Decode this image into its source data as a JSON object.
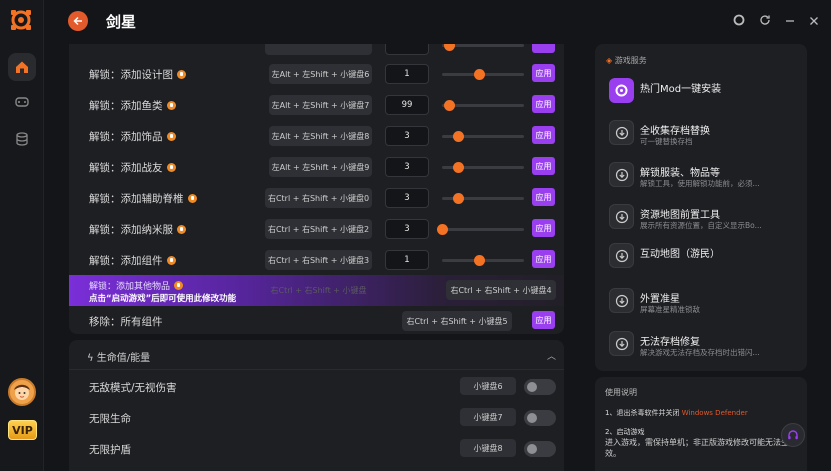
{
  "app": {
    "title": "剑星"
  },
  "rail": {
    "vip_label": "VIP"
  },
  "mods": [
    {
      "label": "解锁：添加设计图",
      "hotkey": "左Alt + 左Shift + 小键盘6",
      "value": "1",
      "slider": 0.45,
      "apply": "应用"
    },
    {
      "label": "解锁：添加鱼类",
      "hotkey": "左Alt + 左Shift + 小键盘7",
      "value": "99",
      "slider": 0.08,
      "apply": "应用"
    },
    {
      "label": "解锁：添加饰品",
      "hotkey": "左Alt + 左Shift + 小键盘8",
      "value": "3",
      "slider": 0.2,
      "apply": "应用"
    },
    {
      "label": "解锁：添加战友",
      "hotkey": "左Alt + 左Shift + 小键盘9",
      "value": "3",
      "slider": 0.2,
      "apply": "应用"
    },
    {
      "label": "解锁：添加辅助脊椎",
      "hotkey": "右Ctrl + 右Shift + 小键盘0",
      "value": "3",
      "slider": 0.2,
      "apply": "应用"
    },
    {
      "label": "解锁：添加纳米服",
      "hotkey": "右Ctrl + 右Shift + 小键盘2",
      "value": "3",
      "slider": 0.0,
      "apply": "应用"
    },
    {
      "label": "解锁：添加组件",
      "hotkey": "右Ctrl + 右Shift + 小键盘3",
      "value": "1",
      "slider": 0.45,
      "apply": "应用"
    }
  ],
  "highlight_row": {
    "label": "解锁：添加其他物品",
    "notice": "点击“启动游戏”后即可使用此修改功能",
    "hotkey_faded": "右Ctrl + 右Shift + 小键盘",
    "hotkey": "右Ctrl + 右Shift + 小键盘4"
  },
  "remove_row": {
    "label": "移除：所有组件",
    "hotkey": "右Ctrl + 右Shift + 小键盘5",
    "apply": "应用"
  },
  "section2": {
    "title": "生命值/能量",
    "toggles": [
      {
        "label": "无敌模式/无视伤害",
        "hotkey": "小键盘6"
      },
      {
        "label": "无限生命",
        "hotkey": "小键盘7"
      },
      {
        "label": "无限护盾",
        "hotkey": "小键盘8"
      }
    ]
  },
  "services": {
    "header": "游戏服务",
    "items": [
      {
        "name": "热门Mod一键安装",
        "desc": ""
      },
      {
        "name": "全收集存档替换",
        "desc": "可一键替换存档"
      },
      {
        "name": "解锁服装、物品等",
        "desc": "解锁工具，使用解锁功能前，必须..."
      },
      {
        "name": "资源地图前置工具",
        "desc": "展示所有资源位置，自定义显示Bo..."
      },
      {
        "name": "互动地图（游民）",
        "desc": ""
      },
      {
        "name": "外置准星",
        "desc": "屏幕准星精准锁敌"
      },
      {
        "name": "无法存档修复",
        "desc": "解决游戏无法存档及存档时出错闪..."
      }
    ]
  },
  "usage": {
    "header": "使用说明",
    "step1_prefix": "1、退出杀毒软件并关闭",
    "step1_highlight": "Windows Defender",
    "step2": "2、启动游戏",
    "step2_detail": "进入游戏，需保持单机；非正版游戏修改可能无法生效。"
  },
  "colors": {
    "accent_orange": "#f37224",
    "accent_purple": "#9a3ff0",
    "bg": "#141518"
  }
}
